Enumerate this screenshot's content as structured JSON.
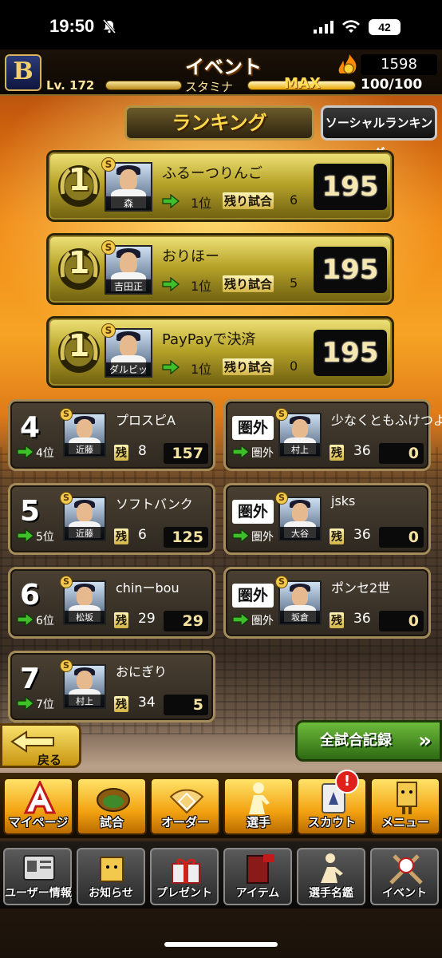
{
  "status_bar": {
    "time": "19:50",
    "battery": "42"
  },
  "header": {
    "team_logo": "B",
    "title": "イベント",
    "level_label": "Lv. 172",
    "stamina_label": "スタミナ",
    "stamina_max": "MAX",
    "stamina_value": "100/100",
    "coins": "1598"
  },
  "ranking": {
    "title": "ランキング",
    "social_button": "ソーシャルランキング",
    "remain_label": "残り試合",
    "remain_short": "残",
    "top_entries": [
      {
        "rank": "1",
        "name": "ふるーつりんご",
        "player": "森",
        "prev_rank": "1位",
        "remaining": "6",
        "score": "195"
      },
      {
        "rank": "1",
        "name": "おりほー",
        "player": "吉田正",
        "prev_rank": "1位",
        "remaining": "5",
        "score": "195"
      },
      {
        "rank": "1",
        "name": "PayPayで決済",
        "player": "ダルビッシュ",
        "prev_rank": "1位",
        "remaining": "0",
        "score": "195"
      }
    ],
    "left_entries": [
      {
        "rank": "4",
        "name": "プロスピA",
        "player": "近藤",
        "prev_rank": "4位",
        "remaining": "8",
        "score": "157"
      },
      {
        "rank": "5",
        "name": "ソフトバンク",
        "player": "近藤",
        "prev_rank": "5位",
        "remaining": "6",
        "score": "125"
      },
      {
        "rank": "6",
        "name": "chinーbou",
        "player": "松坂",
        "prev_rank": "6位",
        "remaining": "29",
        "score": "29"
      },
      {
        "rank": "7",
        "name": "おにぎり",
        "player": "村上",
        "prev_rank": "7位",
        "remaining": "34",
        "score": "5"
      }
    ],
    "right_entries": [
      {
        "rank": "圏外",
        "name": "少なくともふけつより",
        "player": "村上",
        "prev_rank": "圏外",
        "remaining": "36",
        "score": "0"
      },
      {
        "rank": "圏外",
        "name": "jsks",
        "player": "大谷",
        "prev_rank": "圏外",
        "remaining": "36",
        "score": "0"
      },
      {
        "rank": "圏外",
        "name": "ポンセ2世",
        "player": "坂倉",
        "prev_rank": "圏外",
        "remaining": "36",
        "score": "0"
      }
    ]
  },
  "actions": {
    "back": "戻る",
    "all_records": "全試合記録"
  },
  "nav_primary": [
    {
      "label": "マイページ",
      "icon": "mypage-icon"
    },
    {
      "label": "試合",
      "icon": "stadium-icon"
    },
    {
      "label": "オーダー",
      "icon": "field-icon"
    },
    {
      "label": "選手",
      "icon": "player-icon"
    },
    {
      "label": "スカウト",
      "icon": "scout-icon"
    },
    {
      "label": "メニュー",
      "icon": "menu-icon"
    }
  ],
  "notification_badge": "!",
  "nav_secondary": [
    {
      "label": "ユーザー情報",
      "icon": "user-info-icon"
    },
    {
      "label": "お知らせ",
      "icon": "notice-icon"
    },
    {
      "label": "プレゼント",
      "icon": "present-icon"
    },
    {
      "label": "アイテム",
      "icon": "item-icon"
    },
    {
      "label": "選手名鑑",
      "icon": "player-book-icon"
    },
    {
      "label": "イベント",
      "icon": "event-icon"
    }
  ],
  "colors": {
    "gold": "#d8c24a",
    "score_bg": "#0a0a0a",
    "accent_green": "#3fbf2a"
  }
}
